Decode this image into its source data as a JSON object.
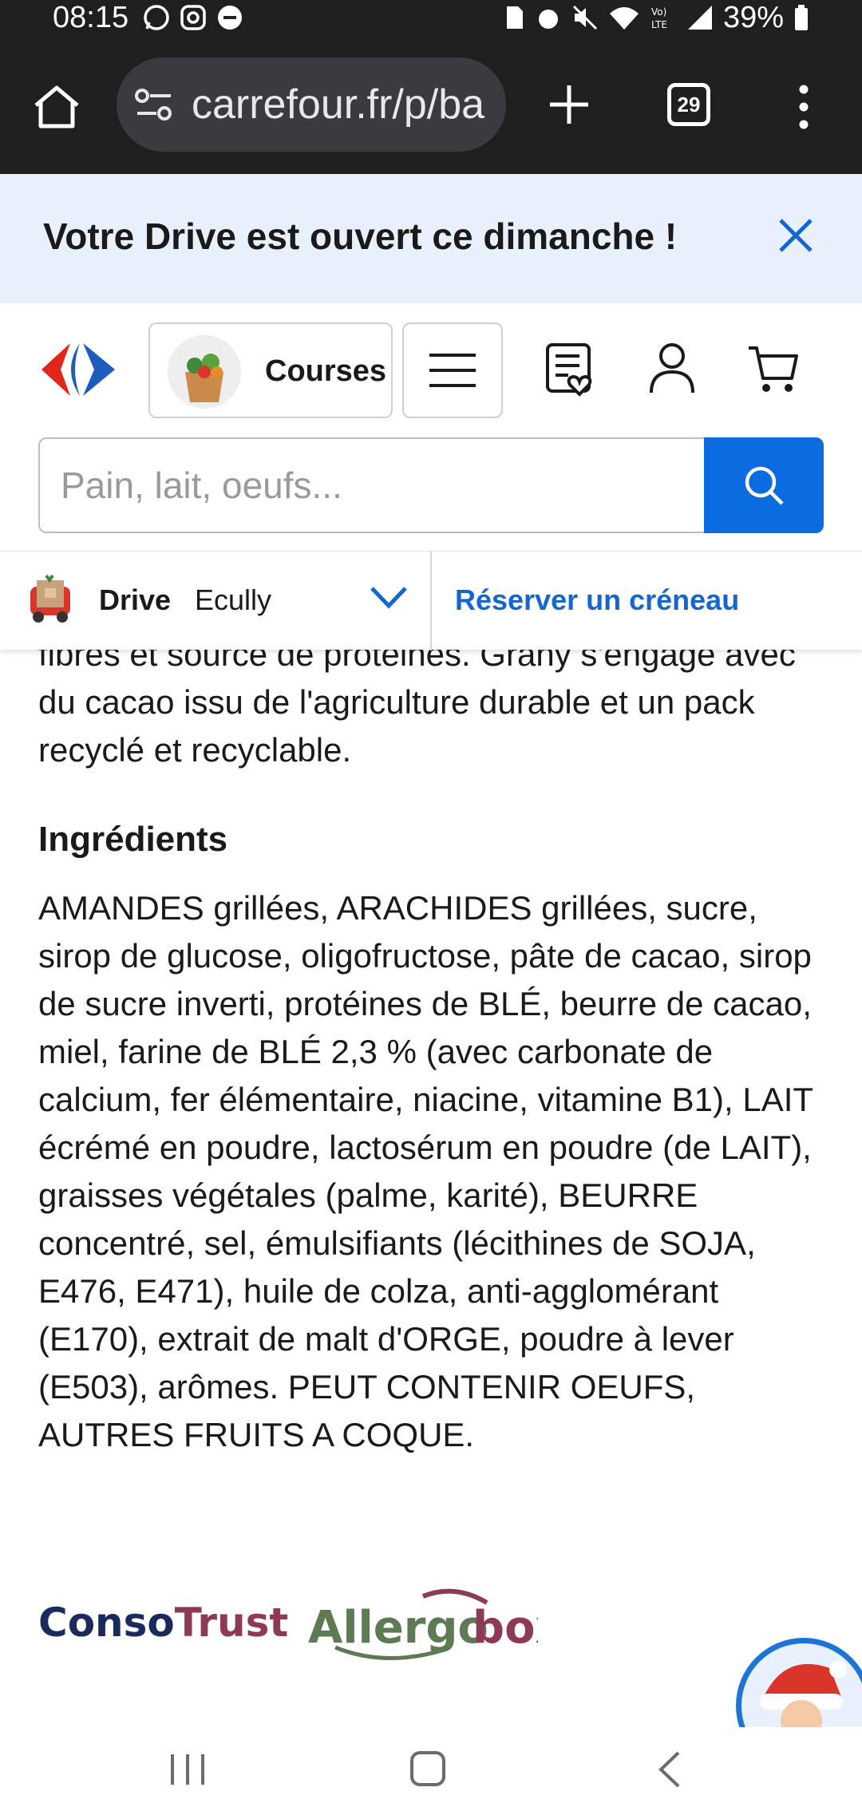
{
  "status_bar": {
    "time": "08:15",
    "battery": "39%",
    "icons": [
      "whatsapp-icon",
      "instagram-icon",
      "app-icon",
      "sim-icon",
      "alarm-icon",
      "mute-icon",
      "wifi-icon",
      "volte-icon",
      "signal-icon",
      "battery-icon"
    ]
  },
  "browser": {
    "url": "carrefour.fr/p/ba",
    "tab_count": "29"
  },
  "promo": {
    "text": "Votre Drive est ouvert ce dimanche !"
  },
  "header": {
    "courses_label": "Courses",
    "search_placeholder": "Pain, lait, oeufs..."
  },
  "drive": {
    "label": "Drive",
    "store": "Ecully",
    "reserve_label": "Réserver un créneau"
  },
  "content": {
    "description": "fibres et source de protéines. Grany s'engage avec du cacao issu de l'agriculture durable et un pack recyclé et recyclable.",
    "ingredients_title": "Ingrédients",
    "ingredients_text": "AMANDES grillées, ARACHIDES grillées, sucre, sirop de glucose, oligofructose, pâte de cacao, sirop de sucre inverti, protéines de BLÉ, beurre de cacao, miel, farine de BLÉ 2,3 % (avec carbonate de calcium, fer élémentaire, niacine, vitamine B1), LAIT écrémé en poudre, lactosérum en poudre (de LAIT), graisses végétales (palme, karité), BEURRE concentré, sel, émulsifiants (lécithines de SOJA, E476, E471), huile de colza, anti-agglomérant (E170), extrait de malt d'ORGE, poudre à lever (E503), arômes. PEUT CONTENIR OEUFS, AUTRES FRUITS A COQUE."
  },
  "logos": {
    "consotrust_a": "Conso",
    "consotrust_b": "Trust",
    "allergobox": "Allergobox"
  },
  "colors": {
    "brand_blue": "#0a6ce0",
    "link_blue": "#1467d1",
    "banner_bg": "#e8f1fb",
    "browser_bg": "#1f1f1f"
  }
}
